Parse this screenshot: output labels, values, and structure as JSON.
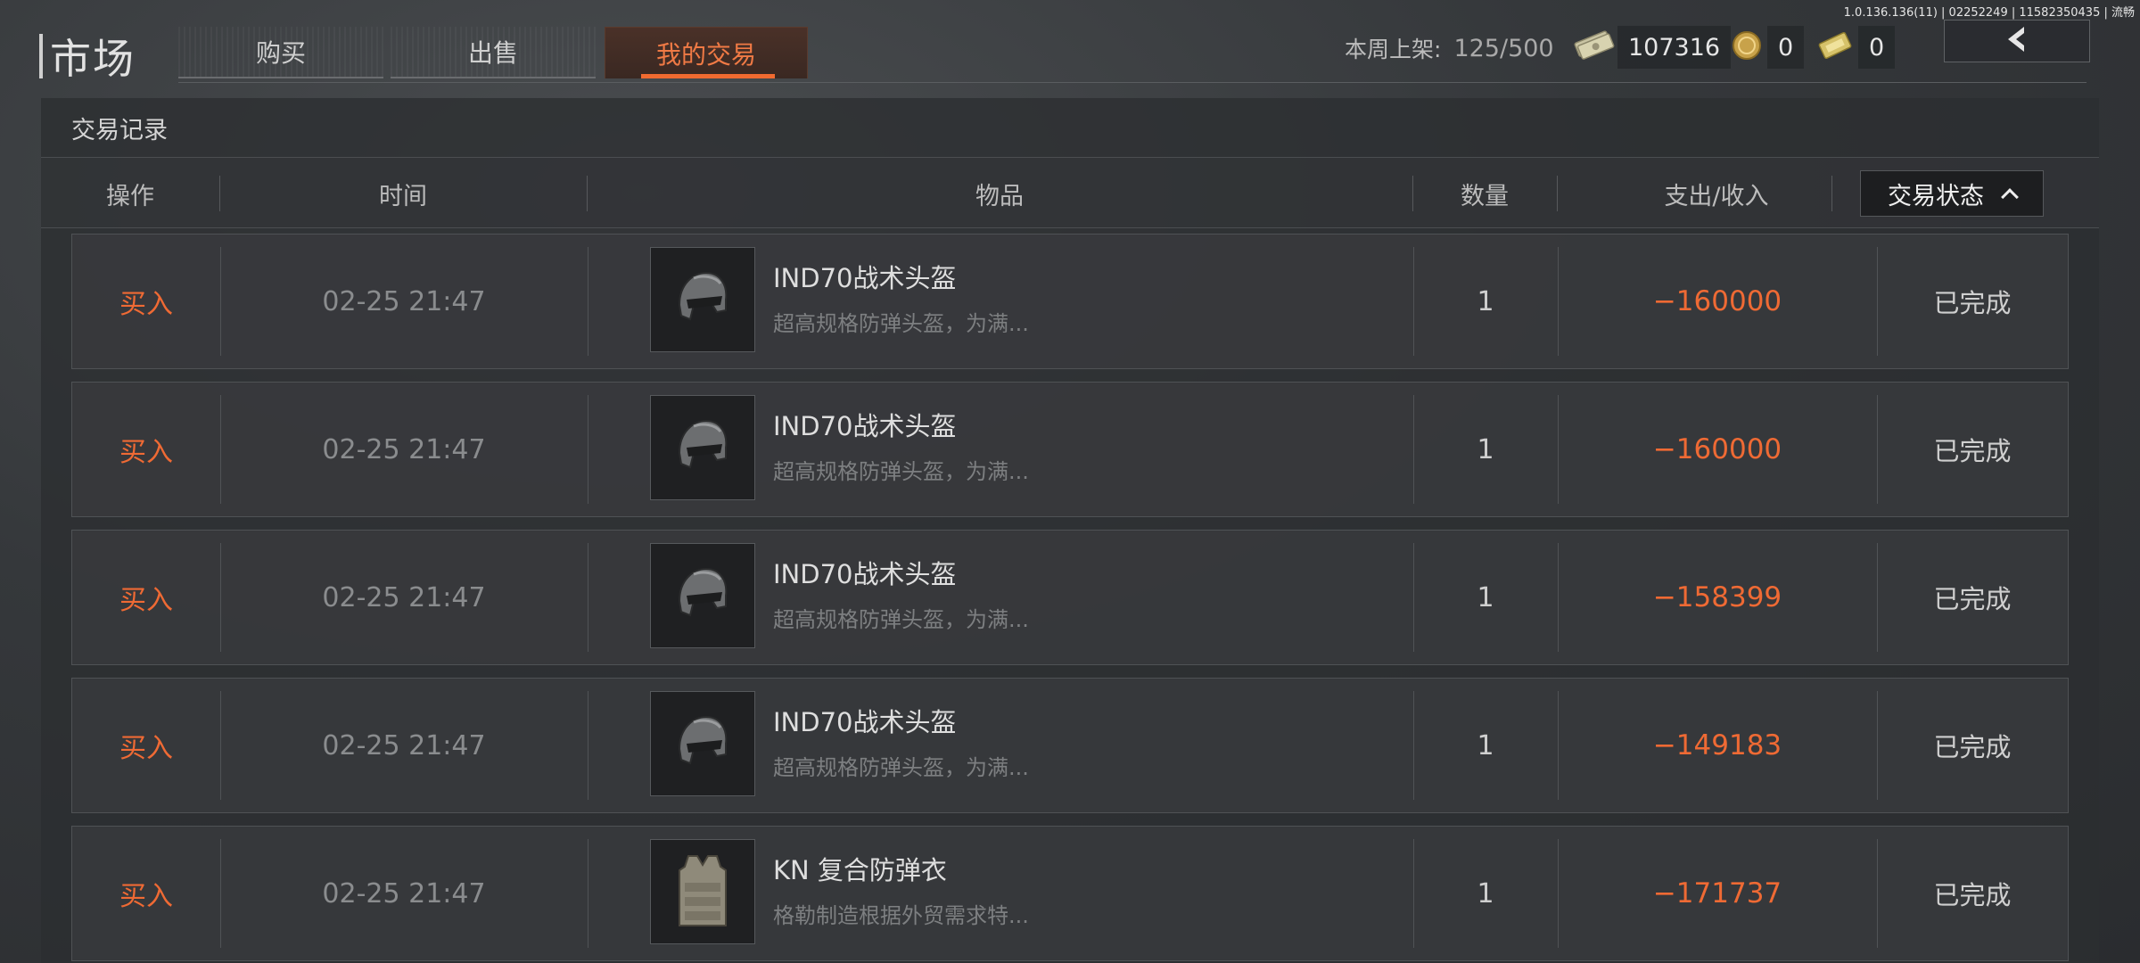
{
  "version": "1.0.136.136(11) | 02252249 | 11582350435 | 流畅",
  "header": {
    "title": "市场",
    "tabs": [
      {
        "label": "购买",
        "active": false
      },
      {
        "label": "出售",
        "active": false
      },
      {
        "label": "我的交易",
        "active": true
      }
    ],
    "weekly_listing_label": "本周上架:",
    "weekly_listing_value": "125/500",
    "currencies": [
      {
        "icon": "cash-bundle-icon",
        "value": "107316"
      },
      {
        "icon": "gold-coin-icon",
        "value": "0"
      },
      {
        "icon": "voucher-icon",
        "value": "0"
      }
    ],
    "back_icon": "chevron-left-icon"
  },
  "panel": {
    "title": "交易记录",
    "columns": [
      "操作",
      "时间",
      "物品",
      "数量",
      "支出/收入"
    ],
    "status_filter_label": "交易状态",
    "rows": [
      {
        "op": "买入",
        "time": "02-25 21:47",
        "item": "IND70战术头盔",
        "desc": "超高规格防弹头盔，为满...",
        "icon": "helmet-icon",
        "qty": "1",
        "amount": "−160000",
        "status": "已完成"
      },
      {
        "op": "买入",
        "time": "02-25 21:47",
        "item": "IND70战术头盔",
        "desc": "超高规格防弹头盔，为满...",
        "icon": "helmet-icon",
        "qty": "1",
        "amount": "−160000",
        "status": "已完成"
      },
      {
        "op": "买入",
        "time": "02-25 21:47",
        "item": "IND70战术头盔",
        "desc": "超高规格防弹头盔，为满...",
        "icon": "helmet-icon",
        "qty": "1",
        "amount": "−158399",
        "status": "已完成"
      },
      {
        "op": "买入",
        "time": "02-25 21:47",
        "item": "IND70战术头盔",
        "desc": "超高规格防弹头盔，为满...",
        "icon": "helmet-icon",
        "qty": "1",
        "amount": "−149183",
        "status": "已完成"
      },
      {
        "op": "买入",
        "time": "02-25 21:47",
        "item": "KN 复合防弹衣",
        "desc": "格勒制造根据外贸需求特...",
        "icon": "body-armor-icon",
        "qty": "1",
        "amount": "−171737",
        "status": "已完成"
      }
    ]
  },
  "colors": {
    "accent": "#ef6a34",
    "panel": "#2c2e31"
  }
}
